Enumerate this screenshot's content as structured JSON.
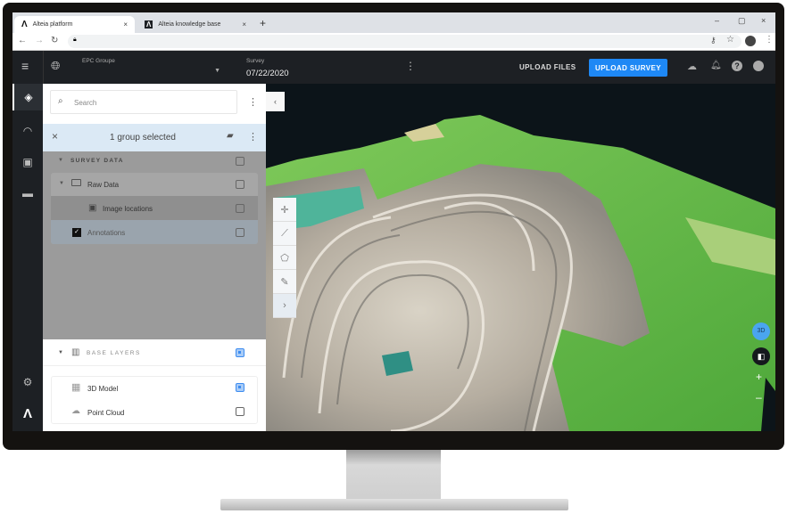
{
  "browser": {
    "tabs": [
      {
        "label": "Alteia platform",
        "active": true
      },
      {
        "label": "Alteia knowledge base",
        "active": false
      }
    ],
    "new_tab": "+",
    "close": "×",
    "window_controls": [
      "–",
      "▢",
      "×"
    ]
  },
  "header": {
    "project_label": "EPC Groupe",
    "project_value": "",
    "survey_label": "Survey",
    "survey_value": "07/22/2020",
    "upload_files": "UPLOAD FILES",
    "upload_survey": "UPLOAD SURVEY",
    "accent": "#1e88f5"
  },
  "panel": {
    "search_placeholder": "Search",
    "selection_text": "1 group selected",
    "survey_section": "SURVEY DATA",
    "items": [
      {
        "label": "Raw Data",
        "checked": false
      },
      {
        "label": "Image locations",
        "checked": false
      },
      {
        "label": "Annotations",
        "checked": true
      }
    ],
    "base_section": "BASE LAYERS",
    "base_items": [
      {
        "label": "3D Model",
        "checked": true
      },
      {
        "label": "Point Cloud",
        "checked": false
      }
    ]
  },
  "map": {
    "mode_badge": "3D",
    "zoom_in": "+",
    "zoom_out": "–"
  }
}
